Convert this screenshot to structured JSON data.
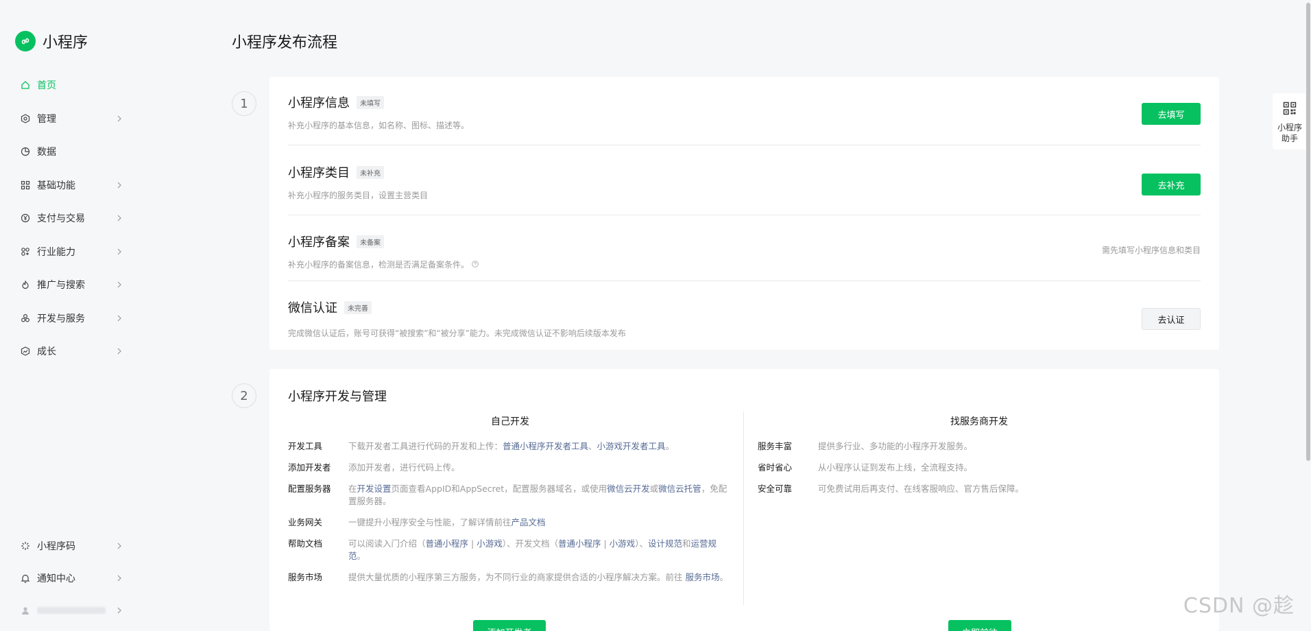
{
  "brand": {
    "name": "小程序"
  },
  "sidebar": {
    "items": [
      {
        "label": "首页",
        "icon": "home-icon",
        "active": true,
        "chevron": false
      },
      {
        "label": "管理",
        "icon": "manage-icon",
        "active": false,
        "chevron": true
      },
      {
        "label": "数据",
        "icon": "chart-pie-icon",
        "active": false,
        "chevron": false
      },
      {
        "label": "基础功能",
        "icon": "grid-icon",
        "active": false,
        "chevron": true
      },
      {
        "label": "支付与交易",
        "icon": "yen-icon",
        "active": false,
        "chevron": true
      },
      {
        "label": "行业能力",
        "icon": "industry-icon",
        "active": false,
        "chevron": true
      },
      {
        "label": "推广与搜索",
        "icon": "flame-icon",
        "active": false,
        "chevron": true
      },
      {
        "label": "开发与服务",
        "icon": "services-icon",
        "active": false,
        "chevron": true
      },
      {
        "label": "成长",
        "icon": "growth-icon",
        "active": false,
        "chevron": true
      }
    ],
    "bottom": [
      {
        "label": "小程序码",
        "icon": "code-icon"
      },
      {
        "label": "通知中心",
        "icon": "bell-icon"
      }
    ]
  },
  "page": {
    "title": "小程序发布流程"
  },
  "steps": [
    "1",
    "2"
  ],
  "step1": {
    "rows": [
      {
        "title": "小程序信息",
        "tag": "未填写",
        "desc": "补充小程序的基本信息，如名称、图标、描述等。",
        "action": "去填写"
      },
      {
        "title": "小程序类目",
        "tag": "未补充",
        "desc": "补充小程序的服务类目，设置主营类目",
        "action": "去补充"
      },
      {
        "title": "小程序备案",
        "tag": "未备案",
        "desc": "补充小程序的备案信息，检测是否满足备案条件。",
        "hint": "需先填写小程序信息和类目"
      },
      {
        "title": "微信认证",
        "tag": "未完善",
        "desc": "完成微信认证后，账号可获得“被搜索”和“被分享”能力。未完成微信认证不影响后续版本发布",
        "action": "去认证"
      }
    ]
  },
  "step2": {
    "title": "小程序开发与管理",
    "self_dev": {
      "head": "自己开发",
      "items": {
        "tools_k": "开发工具",
        "tools_v1": "下载开发者工具进行代码的开发和上传：",
        "tools_link1": "普通小程序开发者工具",
        "tools_sep": "、",
        "tools_link2": "小游戏开发者工具",
        "tools_end": "。",
        "add_k": "添加开发者",
        "add_v": "添加开发者，进行代码上传。",
        "server_k": "配置服务器",
        "server_v1": "在",
        "server_link1": "开发设置",
        "server_v2": "页面查看AppID和AppSecret，配置服务器域名，或使用",
        "server_link2": "微信云开发",
        "server_v3": "或",
        "server_link3": "微信云托管",
        "server_v4": "，免配置服务器。",
        "gateway_k": "业务网关",
        "gateway_v": "一键提升小程序安全与性能，了解详情前往",
        "gateway_link": "产品文档",
        "help_k": "帮助文档",
        "help_v1": "可以阅读入门介绍（",
        "help_link1": "普通小程序",
        "help_bar1": " | ",
        "help_link2": "小游戏",
        "help_v2": "）、开发文档（",
        "help_link3": "普通小程序",
        "help_bar2": " | ",
        "help_link4": "小游戏",
        "help_v3": "）、",
        "help_link5": "设计规范",
        "help_v4": "和",
        "help_link6": "运营规范",
        "help_v5": "。",
        "market_k": "服务市场",
        "market_v": "提供大量优质的小程序第三方服务，为不同行业的商家提供合适的小程序解决方案。前往 ",
        "market_link": "服务市场",
        "market_end": "。"
      },
      "button": "添加开发者"
    },
    "provider_dev": {
      "head": "找服务商开发",
      "items": [
        {
          "k": "服务丰富",
          "v": "提供多行业、多功能的小程序开发服务。"
        },
        {
          "k": "省时省心",
          "v": "从小程序认证到发布上线，全流程支持。"
        },
        {
          "k": "安全可靠",
          "v": "可免费试用后再支付、在线客服响应、官方售后保障。"
        }
      ],
      "button": "立即前往"
    }
  },
  "assistant": {
    "label": "小程序助手"
  },
  "watermark": "CSDN @趁",
  "colors": {
    "brand": "#07c160",
    "link": "#576b95"
  }
}
